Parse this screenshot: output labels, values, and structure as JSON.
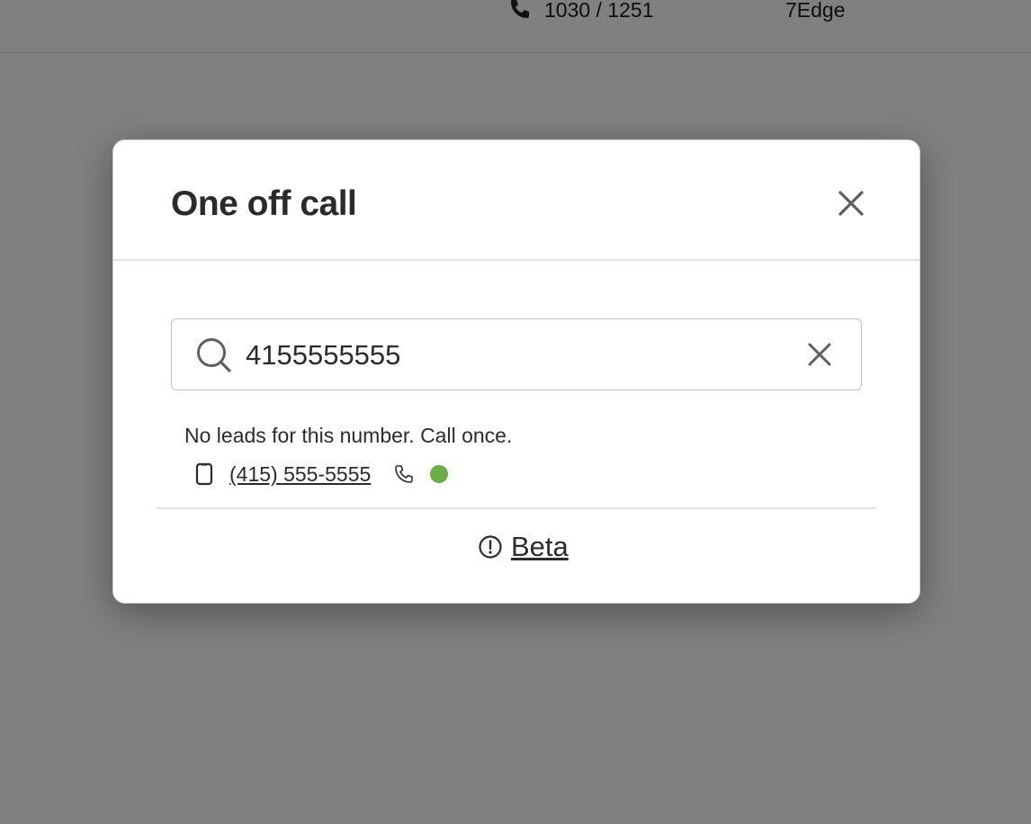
{
  "background": {
    "call_counts": "1030 / 1251",
    "organization": "7Edge",
    "icon": "phone-icon"
  },
  "modal": {
    "title": "One off call",
    "close_icon": "close-icon",
    "search": {
      "value": "4155555555",
      "search_icon": "search-icon",
      "clear_icon": "close-icon"
    },
    "message": "No leads for this number. Call once.",
    "phone_number": {
      "display": "(415) 555-5555",
      "type_icon": "mobile-phone-icon",
      "call_icon": "phone-icon",
      "status_color": "#6aac45"
    },
    "footer": {
      "icon": "info-circle-icon",
      "label": "Beta"
    }
  }
}
